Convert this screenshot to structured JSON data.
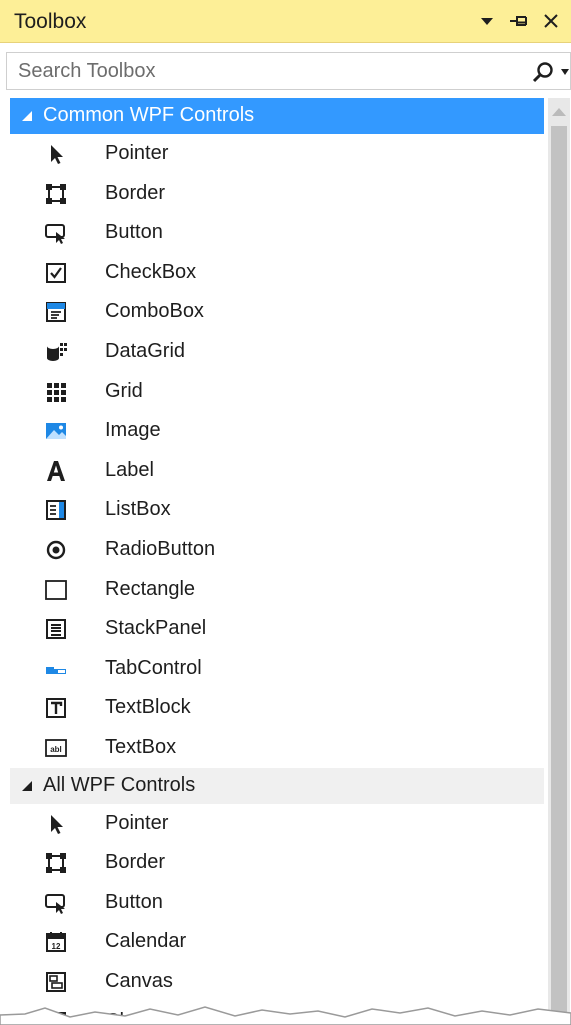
{
  "window": {
    "title": "Toolbox",
    "controls": {
      "dropdown": "chevron-down-icon",
      "pin": "pin-icon",
      "close": "close-icon"
    }
  },
  "search": {
    "placeholder": "Search Toolbox",
    "value": ""
  },
  "groups": [
    {
      "label": "Common WPF Controls",
      "expanded": true,
      "selected": true,
      "items": [
        {
          "label": "Pointer",
          "icon": "pointer-icon"
        },
        {
          "label": "Border",
          "icon": "border-icon"
        },
        {
          "label": "Button",
          "icon": "button-icon"
        },
        {
          "label": "CheckBox",
          "icon": "checkbox-icon"
        },
        {
          "label": "ComboBox",
          "icon": "combobox-icon"
        },
        {
          "label": "DataGrid",
          "icon": "datagrid-icon"
        },
        {
          "label": "Grid",
          "icon": "grid-icon"
        },
        {
          "label": "Image",
          "icon": "image-icon"
        },
        {
          "label": "Label",
          "icon": "label-icon"
        },
        {
          "label": "ListBox",
          "icon": "listbox-icon"
        },
        {
          "label": "RadioButton",
          "icon": "radiobutton-icon"
        },
        {
          "label": "Rectangle",
          "icon": "rectangle-icon"
        },
        {
          "label": "StackPanel",
          "icon": "stackpanel-icon"
        },
        {
          "label": "TabControl",
          "icon": "tabcontrol-icon"
        },
        {
          "label": "TextBlock",
          "icon": "textblock-icon"
        },
        {
          "label": "TextBox",
          "icon": "textbox-icon"
        }
      ]
    },
    {
      "label": "All WPF Controls",
      "expanded": true,
      "selected": false,
      "items": [
        {
          "label": "Pointer",
          "icon": "pointer-icon"
        },
        {
          "label": "Border",
          "icon": "border-icon"
        },
        {
          "label": "Button",
          "icon": "button-icon"
        },
        {
          "label": "Calendar",
          "icon": "calendar-icon"
        },
        {
          "label": "Canvas",
          "icon": "canvas-icon"
        },
        {
          "label": "CheckBox",
          "icon": "checkbox-icon"
        }
      ]
    }
  ],
  "colors": {
    "title_bar": "#fdef97",
    "selection": "#3399ff",
    "group_header": "#f0f0f0",
    "icon_accent": "#1e88e5"
  }
}
